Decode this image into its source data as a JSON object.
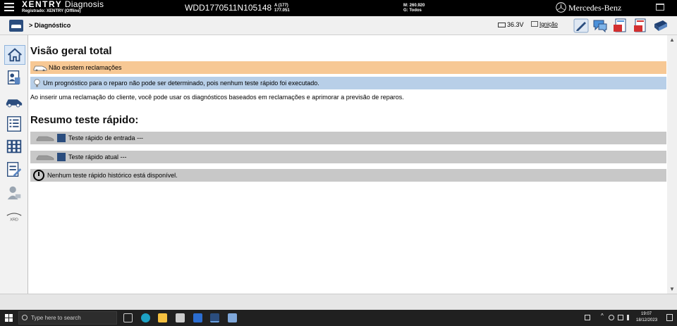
{
  "header": {
    "app_name_bold": "XENTRY",
    "app_name_rest": "Diagnosis",
    "registered": "Registrado: XENTRY (Offline)",
    "vin": "WDD1770511N105148",
    "model_line1": "A (177)",
    "model_line2": "177.051",
    "engine_line1": "M: 260.920",
    "engine_line2": "G: Todos",
    "brand": "Mercedes-Benz"
  },
  "toolbar": {
    "breadcrumb": "> Diagnóstico",
    "voltage": "36.3V",
    "ignition": "Ignição"
  },
  "main": {
    "title": "Visão geral total",
    "complaints": "Não existem reclamações",
    "prognosis": "Um prognóstico para o reparo não pode ser determinado, pois nenhum teste rápido foi executado.",
    "info": "Ao inserir uma reclamação do cliente, você pode usar os diagnósticos baseados em reclamações e aprimorar a previsão de reparos.",
    "quicktest_title": "Resumo teste rápido:",
    "quicktest_entry": "Teste rápido de entrada ---",
    "quicktest_current": "Teste rápido atual ---",
    "quicktest_history": "Nenhum teste rápido histórico está disponível."
  },
  "leftnav": {
    "xrd_label": "XRD"
  },
  "taskbar": {
    "search_placeholder": "Type here to search",
    "time": "19:07",
    "date": "18/12/2023"
  },
  "colors": {
    "complaints_bg": "#f7c894",
    "prognosis_bg": "#b8cfe8",
    "quicktest_bg": "#c8c8c8",
    "nav_active": "#dbe8f7",
    "brand_blue": "#2b4d7e"
  }
}
